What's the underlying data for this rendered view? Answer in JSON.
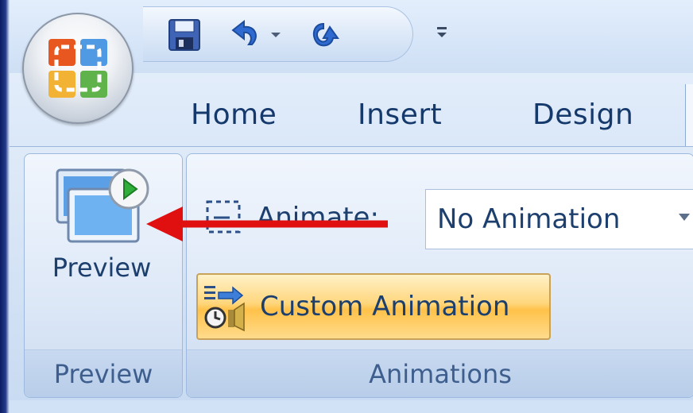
{
  "quick_access": {
    "items": [
      {
        "name": "save",
        "icon": "floppy-disk-icon"
      },
      {
        "name": "undo",
        "icon": "undo-icon"
      },
      {
        "name": "undo-dropdown",
        "icon": "chevron-down-icon"
      },
      {
        "name": "redo",
        "icon": "redo-icon"
      },
      {
        "name": "customize",
        "icon": "customize-toolbar-icon"
      }
    ]
  },
  "tabs": [
    {
      "label": "Home"
    },
    {
      "label": "Insert"
    },
    {
      "label": "Design"
    }
  ],
  "ribbon": {
    "preview_group": {
      "button_label": "Preview",
      "group_label": "Preview"
    },
    "animations_group": {
      "animate_label": "Animate:",
      "animate_value": "No Animation",
      "custom_animation_label": "Custom Animation",
      "group_label": "Animations"
    }
  },
  "colors": {
    "accent_tab_text": "#15396b",
    "custom_button_highlight": "#ffc24a",
    "annotation_arrow": "#e01010"
  }
}
